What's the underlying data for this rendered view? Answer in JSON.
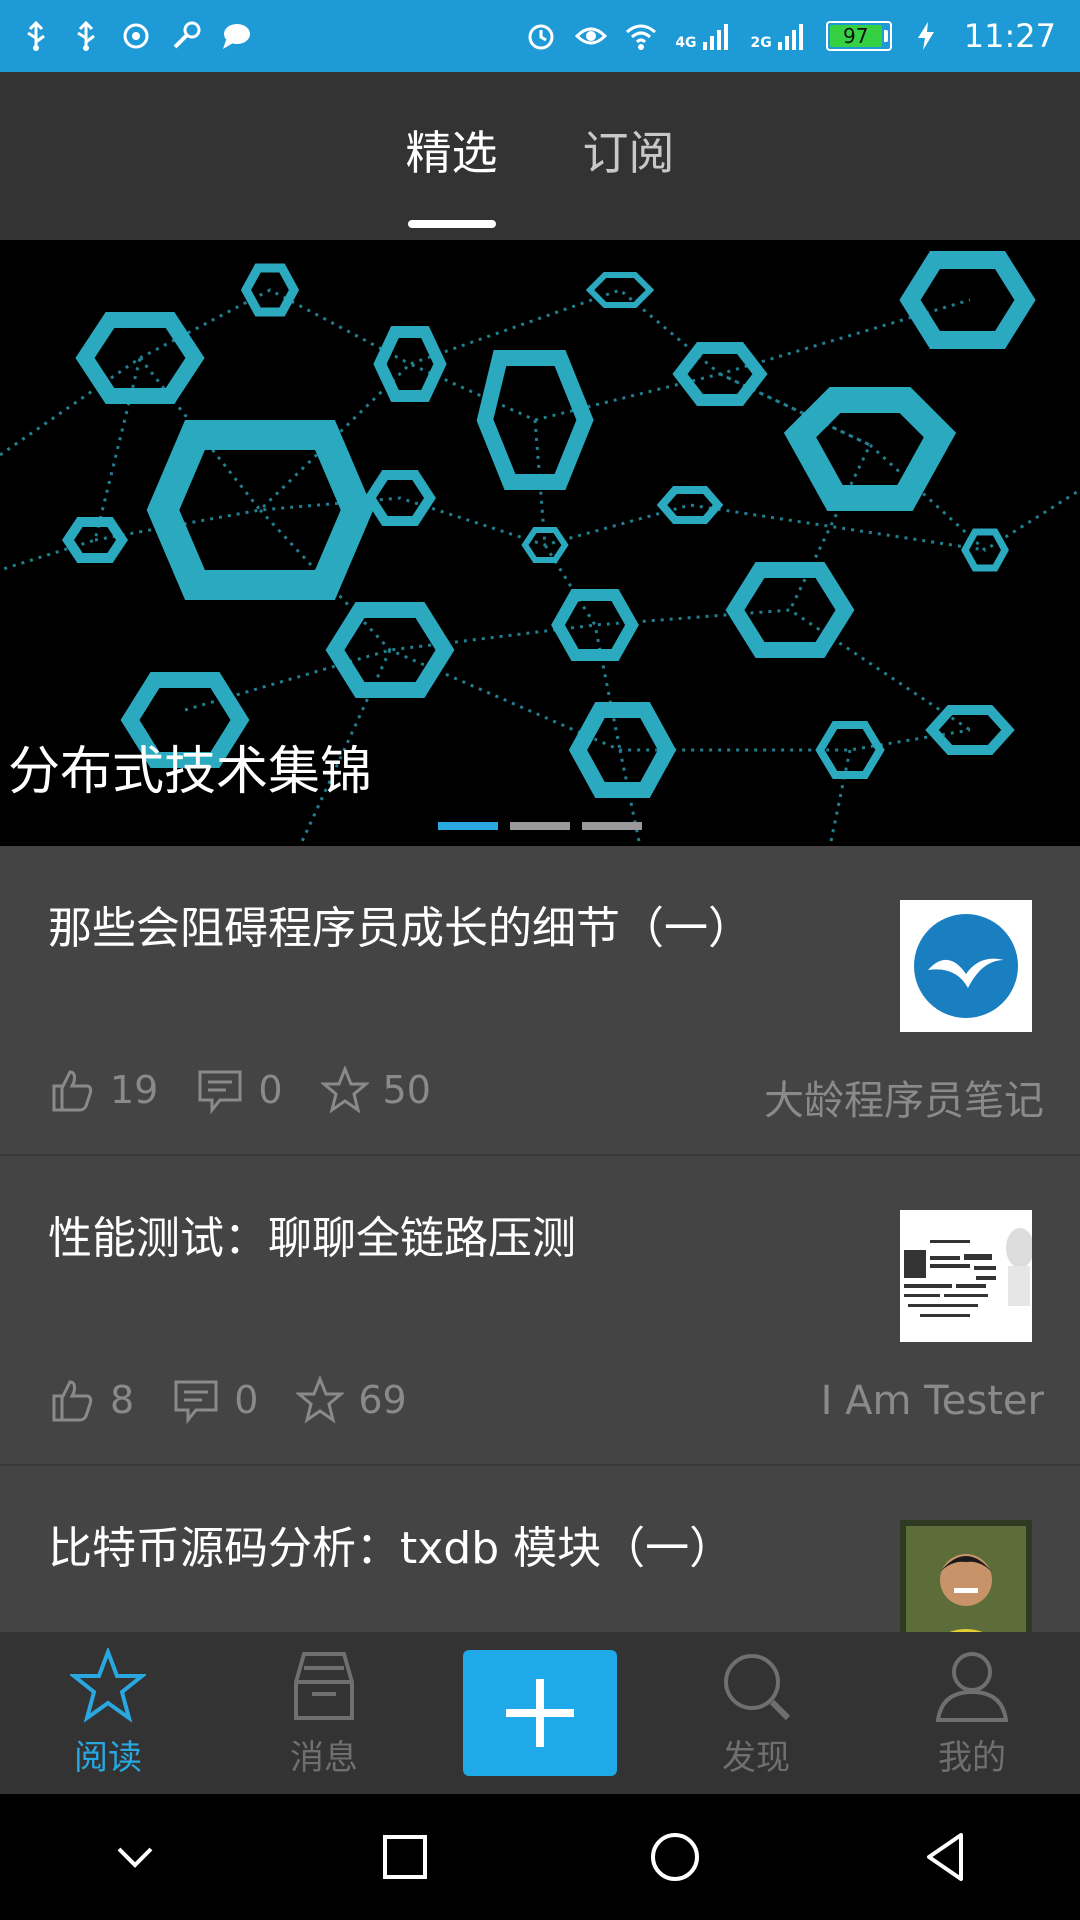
{
  "status_bar": {
    "time": "11:27",
    "battery": "97",
    "network_1": "4G",
    "network_2": "2G"
  },
  "tabs": [
    {
      "label": "精选",
      "active": true
    },
    {
      "label": "订阅",
      "active": false
    }
  ],
  "banner": {
    "title": "分布式技术集锦",
    "slides": 3,
    "active_slide": 1
  },
  "articles": [
    {
      "title": "那些会阻碍程序员成长的细节（一）",
      "likes": "19",
      "comments": "0",
      "stars": "50",
      "author": "大龄程序员笔记",
      "thumb": "logo-icon"
    },
    {
      "title": "性能测试：聊聊全链路压测",
      "likes": "8",
      "comments": "0",
      "stars": "69",
      "author": "I Am Tester",
      "thumb": "word-cloud"
    },
    {
      "title": "比特币源码分析：txdb 模块（一）",
      "thumb": "avatar-photo"
    }
  ],
  "bottom_nav": [
    {
      "label": "阅读",
      "icon": "star-icon",
      "active": true
    },
    {
      "label": "消息",
      "icon": "inbox-icon",
      "active": false
    },
    {
      "label": "",
      "icon": "plus-icon",
      "active": false
    },
    {
      "label": "发现",
      "icon": "search-icon",
      "active": false
    },
    {
      "label": "我的",
      "icon": "user-icon",
      "active": false
    }
  ],
  "colors": {
    "status_bar": "#1e9bd7",
    "accent": "#29a7df",
    "background": "#444444",
    "header": "#333333"
  }
}
